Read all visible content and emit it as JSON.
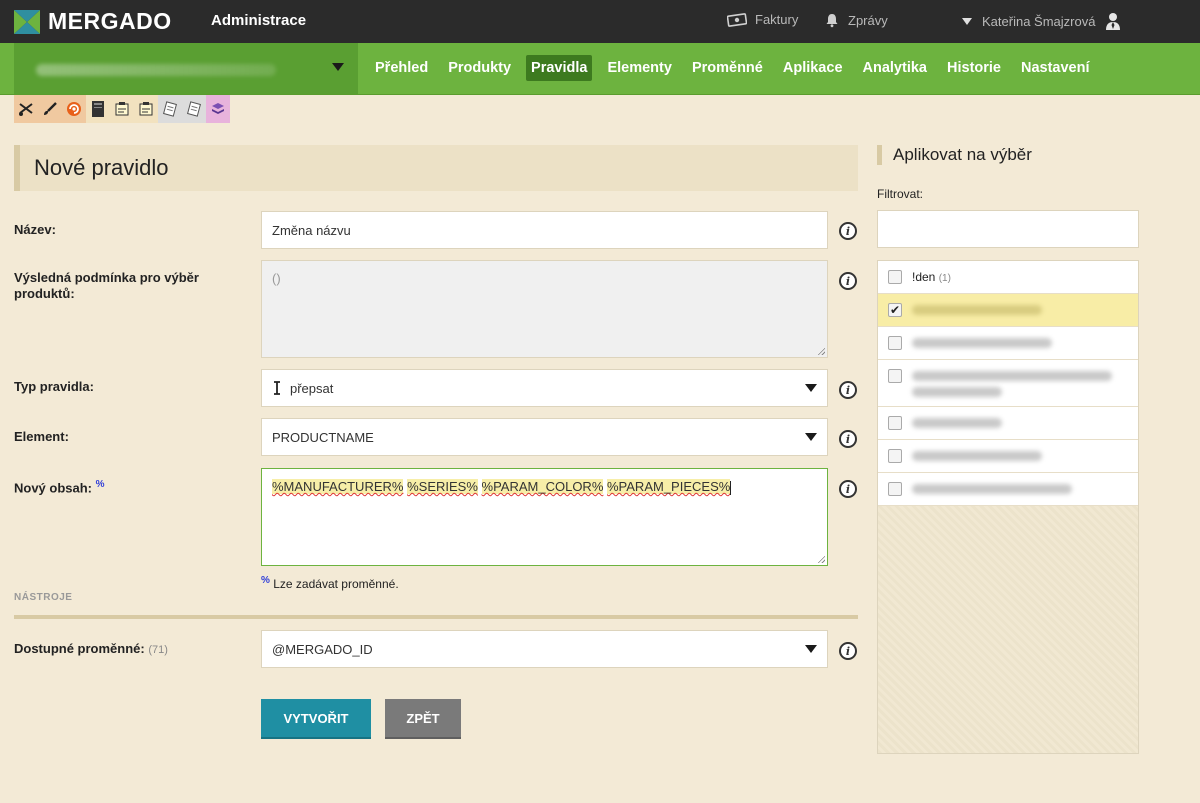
{
  "header": {
    "brand": "MERGADO",
    "section": "Administrace",
    "links": {
      "invoices": "Faktury",
      "messages": "Zprávy",
      "user": "Kateřina Šmajzrová"
    }
  },
  "nav": {
    "items": [
      "Přehled",
      "Produkty",
      "Pravidla",
      "Elementy",
      "Proměnné",
      "Aplikace",
      "Analytika",
      "Historie",
      "Nastavení"
    ],
    "active": "Pravidla"
  },
  "tools": [
    "scissors-icon",
    "brush-icon",
    "swirl-icon",
    "book-icon",
    "note-icon",
    "note-icon",
    "sheet-icon",
    "sheet-icon",
    "stack-icon"
  ],
  "form": {
    "title": "Nové pravidlo",
    "name_label": "Název:",
    "name_value": "Změna názvu",
    "condition_label": "Výsledná podmínka pro výběr produktů:",
    "condition_value": "()",
    "type_label": "Typ pravidla:",
    "type_value": "přepsat",
    "element_label": "Element:",
    "element_value": "PRODUCTNAME",
    "content_label": "Nový obsah:",
    "content_marker": "%",
    "content_tokens": [
      "%MANUFACTURER%",
      "%SERIES%",
      "%PARAM_COLOR%",
      "%PARAM_PIECES%"
    ],
    "hint_marker": "%",
    "hint": "Lze zadávat proměnné.",
    "tools_section": "NÁSTROJE",
    "vars_label": "Dostupné proměnné:",
    "vars_count": "(71)",
    "vars_value": "@MERGADO_ID",
    "info_glyph": "i",
    "create_button": "VYTVOŘIT",
    "back_button": "ZPĚT"
  },
  "side": {
    "title": "Aplikovat na výběr",
    "filter_label": "Filtrovat:",
    "filter_value": "",
    "items": [
      {
        "label": "!den",
        "count": "(1)",
        "checked": false
      },
      {
        "label": "",
        "count": "",
        "checked": true
      },
      {
        "label": "",
        "count": "",
        "checked": false
      },
      {
        "label": "",
        "count": "",
        "checked": false
      },
      {
        "label": "",
        "count": "",
        "checked": false
      },
      {
        "label": "",
        "count": "",
        "checked": false
      },
      {
        "label": "",
        "count": "",
        "checked": false
      }
    ],
    "check_glyph": "✔"
  },
  "colors": {
    "topbar": "#2b2b2b",
    "nav_green": "#6db33f",
    "nav_active": "#3d7a1f",
    "page_bg": "#f3ead6",
    "primary_button": "#1f8fa3",
    "secondary_button": "#7a7a7a",
    "checked_row": "#f8eda6"
  }
}
